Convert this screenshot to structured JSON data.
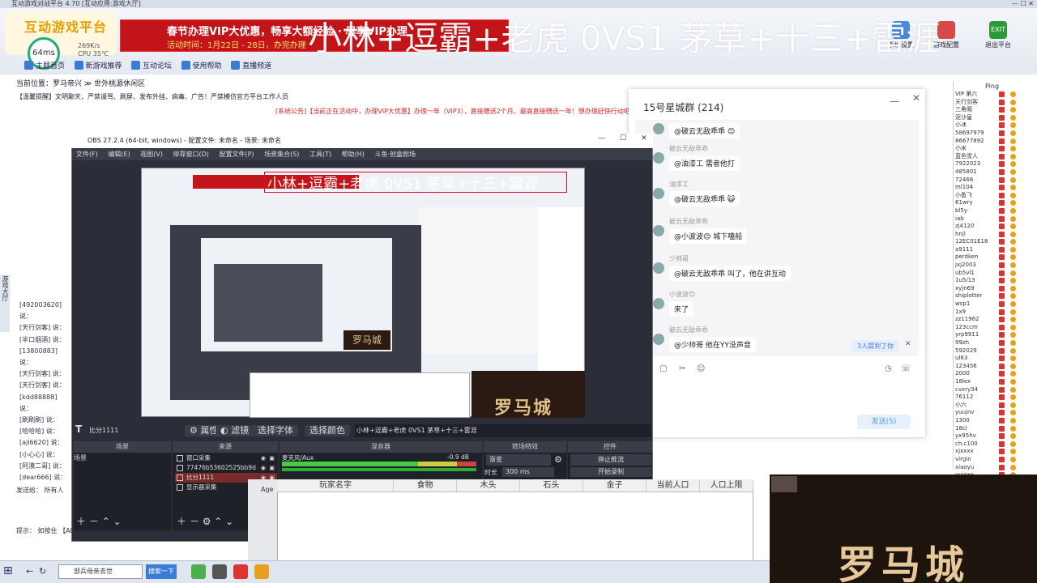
{
  "host": {
    "title": "互动游戏对战平台 4.70 [互动应用:游戏大厅]",
    "logo_text": "互动游戏平台",
    "net_ring": "64ms",
    "stats": [
      "269K/s",
      "CPU 35℃"
    ],
    "banner_line1": "春节办理VIP大优惠，畅享大额经验 · 尽享VIP办理",
    "banner_line2": "活动时间：1月22日 - 28日，办完办理",
    "overlay_title": "小林+逗霸+老虎 0VS1 茅草+十三+雷涯",
    "nav": [
      "主题首页",
      "新游戏推荐",
      "互动论坛",
      "使用帮助",
      "直播频道"
    ],
    "tools": [
      {
        "label": "系统设置",
        "icon": "gear-icon"
      },
      {
        "label": "游戏配置",
        "icon": "game-icon"
      },
      {
        "label": "退出平台",
        "icon": "exit-icon"
      }
    ],
    "exit_icon_text": "EXIT",
    "position": "当前位置：罗马帝兴 ≫ 世外桃源休闲区",
    "announce": "【温馨提醒】文明聊天，严禁谩骂、刷屏、发布外挂、病毒、广告！严禁模仿官方平台工作人员",
    "sys_notice": "[系统公告]【当前正在活动中，办理VIP大优惠】办理一年（VIP3），直接赠送2个月，最高直接赠送一年！想办理赶快行动吧！",
    "left_vertical": "游戏大厅",
    "chat_log": [
      "[492003620] 说：",
      "[天行剑客] 说：",
      "[半口烟酒] 说：",
      "[13800883] 说：",
      "[天行剑客] 说：",
      "[天行剑客] 说：",
      "[kdd88888] 说：",
      "[刷刷刷] 说：",
      "[哈哈哈] 说：",
      "[ajl6620] 说：",
      "[小心心] 说：",
      "[阿漠二哥] 说：",
      "[dear666] 说："
    ],
    "send_to": "发送给：  所有人",
    "hint": "提示：   如按住 【Alt】"
  },
  "player_list": {
    "ping_label": "Ping",
    "rows": [
      "VIP 第六",
      "天行剑客",
      "三角阁",
      "泥沙皇",
      "小冰",
      "58697979",
      "86677892",
      "小米",
      "蓝色雪人",
      "7922023",
      "485801",
      "72466",
      "ml104",
      "小鱼飞",
      "61wry",
      "bl5y",
      "iab",
      "zj4120",
      "hnjl",
      "12EC01E18",
      "a9111",
      "perdken",
      "jxj2003",
      "ub5vl1",
      "1u5/13",
      "xyjn69",
      "shiplotter",
      "wsp1",
      "1x9",
      "zz11962",
      "123ccm",
      "yrp9911",
      "99zh",
      "592029",
      "ul63",
      "123456",
      "2000",
      "18lex",
      "cvxry34",
      "76112",
      "小六",
      "yuujnv",
      "1300",
      "18cl",
      "yx95hv",
      "ch.c100",
      "xjxxxx",
      "virgin",
      "xiaoyu",
      "yujxxx"
    ]
  },
  "chat": {
    "title": "15号星城群 (214)",
    "messages": [
      {
        "nick": "",
        "text": "@破云无敌乖乖 😊"
      },
      {
        "nick": "破云无敌乖乖",
        "text": "@油漆工 需者他打"
      },
      {
        "nick": "油漆工",
        "text": "@破云无敌乖乖 😺"
      },
      {
        "nick": "破云无敌乖乖",
        "text": "@小波波😊 城下嗑船"
      },
      {
        "nick": "少帅哥",
        "text": "@破云无敌乖乖 叫了，他在讲互动"
      },
      {
        "nick": "小波波😊",
        "text": "来了"
      },
      {
        "nick": "破云无敌乖乖",
        "text": "@少帅哥 他在YY没声音"
      }
    ],
    "mention": "3人提到了你",
    "send": "发送(S)"
  },
  "obs": {
    "title": "OBS 27.2.4 (64-bit, windows) - 配置文件: 未命名 - 场景: 未命名",
    "menus": [
      "文件(F)",
      "编辑(E)",
      "视图(V)",
      "停靠窗口(D)",
      "配置文件(P)",
      "场景集合(S)",
      "工具(T)",
      "帮助(H)",
      "斗鱼·创盒剧场"
    ],
    "preview_title": "小林+逗霸+老虎 0VS1 茅草+十三+雷涯",
    "preview_logo": "罗马城",
    "source_label": "比分1111",
    "props_btn": "属性",
    "filter_btn": "滤镜",
    "font_btn": "选择字体",
    "color_btn": "选择颜色",
    "text_value": "小林+逗霸+老虎 0VS1 茅草+十三+雷涯",
    "docks": [
      "场景",
      "来源",
      "混音器",
      "转场特效",
      "控件"
    ],
    "scene_item": "场景",
    "sources": [
      "窗口采集",
      "77476b53602525bb9d",
      "比分1111",
      "显示器采集"
    ],
    "mixer_name": "麦克风/Aux",
    "mixer_value": "-0.9 dB",
    "transition": "渐变",
    "duration_label": "时长",
    "duration_value": "300 ms",
    "stop_stream": "停止推流",
    "start_record": "开始录制"
  },
  "grid": {
    "columns": [
      "玩家名字",
      "食物",
      "木头",
      "石头",
      "金子",
      "当前人口",
      "人口上限"
    ],
    "side_label": "Age"
  },
  "video": {
    "logo": "罗马城"
  },
  "taskbar": {
    "search_value": "部兵母亲去世",
    "search_btn": "搜索一下"
  }
}
